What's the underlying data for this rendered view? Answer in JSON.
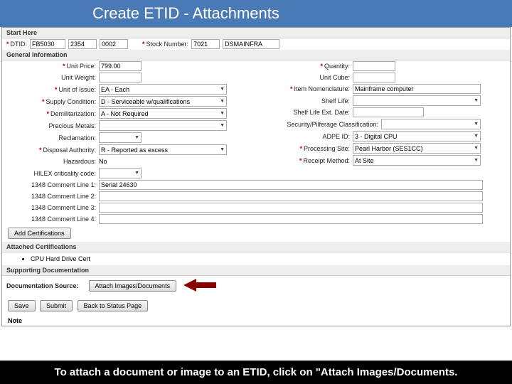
{
  "header": {
    "title": "Create ETID - Attachments"
  },
  "start": {
    "section": "Start Here",
    "dtid_label": "DTID:",
    "dtid1": "FB5030",
    "dtid2": "2354",
    "dtid3": "0002",
    "stock_label": "Stock Number:",
    "stock1": "7021",
    "stock2": "DSMAINFRA"
  },
  "gen": {
    "section": "General Information",
    "unit_price_label": "Unit Price:",
    "unit_price": "799.00",
    "unit_weight_label": "Unit Weight:",
    "unit_issue_label": "Unit of Issue:",
    "unit_issue": "EA - Each",
    "supply_cond_label": "Supply Condition:",
    "supply_cond": "D - Serviceable w/qualifications",
    "demil_label": "Demilitarization:",
    "demil": "A - Not Required",
    "precious_label": "Precious Metals:",
    "reclaim_label": "Reclamation:",
    "disposal_label": "Disposal Authority:",
    "disposal": "R - Reported as excess",
    "hazardous_label": "Hazardous:",
    "hazardous": "No",
    "hilex_label": "HILEX criticality code:",
    "qty_label": "Quantity:",
    "cube_label": "Unit Cube:",
    "nomen_label": "Item Nomenclature:",
    "nomen": "Mainframe computer",
    "shelf_label": "Shelf Life:",
    "shelf_ext_label": "Shelf Life Ext. Date:",
    "sec_label": "Security/Pilferage Classification:",
    "adpe_label": "ADPE ID:",
    "adpe": "3 - Digital CPU",
    "proc_label": "Processing Site:",
    "proc": "Pearl Harbor (SES1CC)",
    "receipt_label": "Receipt Method:",
    "receipt": "At Site",
    "c1_label": "1348 Comment Line 1:",
    "c1": "Serial 24630",
    "c2_label": "1348 Comment Line 2:",
    "c3_label": "1348 Comment Line 3:",
    "c4_label": "1348 Comment Line 4:"
  },
  "cert": {
    "add_btn": "Add Certifications",
    "section": "Attached Certifications",
    "item1": "CPU Hard Drive Cert"
  },
  "doc": {
    "section": "Supporting Documentation",
    "src_label": "Documentation Source:",
    "attach_btn": "Attach Images/Documents"
  },
  "actions": {
    "save": "Save",
    "submit": "Submit",
    "back": "Back to Status Page"
  },
  "note": "Note",
  "footer": "To attach a document or image to an ETID, click on \"Attach Images/Documents."
}
